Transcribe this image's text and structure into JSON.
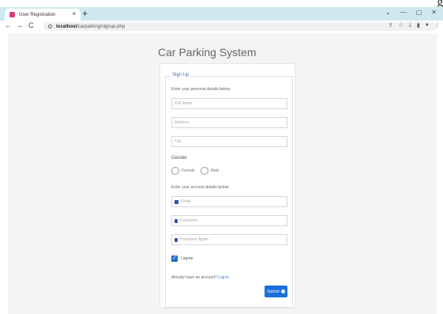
{
  "corner_text": "g",
  "browser": {
    "tab_title": "User Registration",
    "tab_close": "×",
    "new_tab": "+",
    "win_min": "⌄",
    "win_restore": "—",
    "win_max": "▢",
    "win_close": "✕",
    "back": "←",
    "forward": "→",
    "reload": "C",
    "url_host": "localhost",
    "url_path": "/carparking/signup.php"
  },
  "page": {
    "title": "Car Parking System",
    "legend": "Sign Up",
    "personal_label": "Enter your personal details below:",
    "fullname_placeholder": "Full Name",
    "address_placeholder": "Address",
    "city_placeholder": "City",
    "gender_label": "Gender",
    "female_label": "Female",
    "male_label": "Male",
    "account_label": "Enter your account details below:",
    "email_placeholder": "Email",
    "password_placeholder": "Password",
    "password_again_placeholder": "Password Again",
    "agree_label": "I agree",
    "already_text": "Already have an account?",
    "login_link": "Log in",
    "submit_label": "Submit"
  }
}
